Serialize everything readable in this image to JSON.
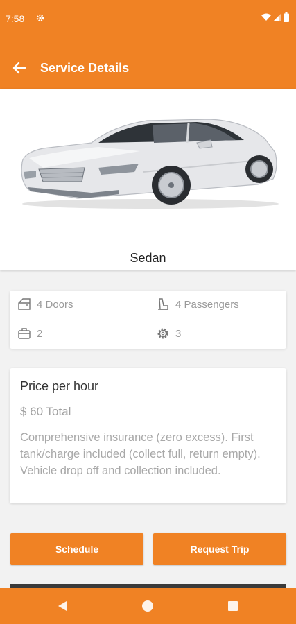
{
  "status_bar": {
    "time": "7:58",
    "icons": [
      "gear-icon",
      "wifi-icon",
      "signal-icon",
      "battery-icon"
    ]
  },
  "header": {
    "title": "Service Details",
    "back_icon": "arrow-left-icon"
  },
  "vehicle": {
    "name": "Sedan"
  },
  "specs": {
    "doors": "4 Doors",
    "passengers": "4 Passengers",
    "luggage": "2",
    "transmission": "3"
  },
  "pricing": {
    "title": "Price per hour",
    "total": "$ 60 Total",
    "description": "Comprehensive insurance (zero excess). First tank/charge included (collect full, return empty). Vehicle drop off and collection included."
  },
  "actions": {
    "schedule": "Schedule",
    "request_trip": "Request Trip"
  },
  "colors": {
    "primary": "#f08224",
    "background": "#f2f2f2",
    "card": "#ffffff",
    "muted_text": "#a0a0a0"
  }
}
